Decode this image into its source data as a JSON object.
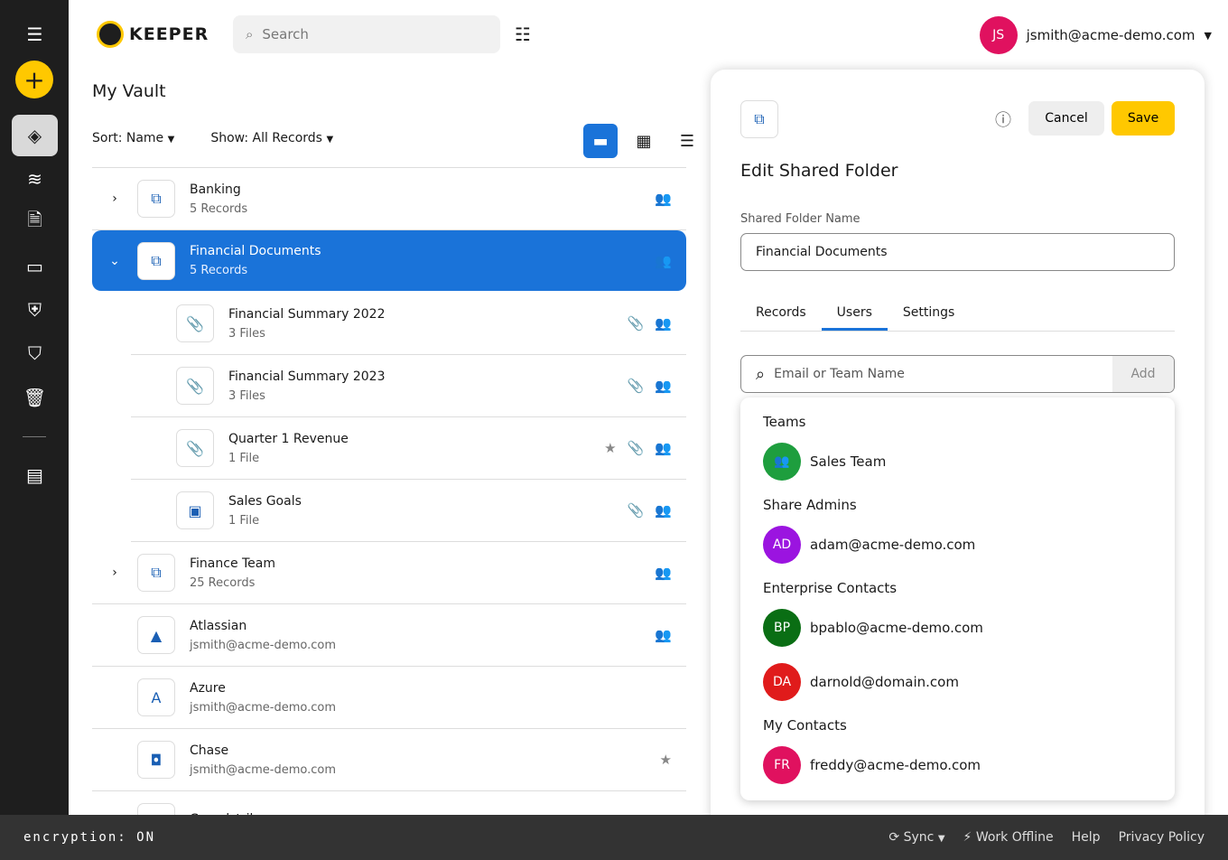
{
  "header": {
    "logo": "KEEPER",
    "search_placeholder": "Search",
    "user_initials": "JS",
    "user_email": "jsmith@acme-demo.com",
    "avatar_color": "#e0115f"
  },
  "vault": {
    "title": "My Vault",
    "sort": "Sort: Name",
    "show": "Show: All Records"
  },
  "records": [
    {
      "title": "Banking",
      "sub": "5 Records",
      "type": "folder",
      "expand": "collapsed",
      "icons": [
        "shared"
      ]
    },
    {
      "title": "Financial Documents",
      "sub": "5 Records",
      "type": "folder",
      "expand": "expanded",
      "selected": true,
      "icons": [
        "shared"
      ]
    },
    {
      "title": "Financial Summary 2022",
      "sub": "3 Files",
      "type": "attachment",
      "child": true,
      "icons": [
        "attachment",
        "shared"
      ]
    },
    {
      "title": "Financial Summary 2023",
      "sub": "3 Files",
      "type": "attachment",
      "child": true,
      "icons": [
        "attachment",
        "shared"
      ]
    },
    {
      "title": "Quarter 1 Revenue",
      "sub": "1 File",
      "type": "attachment",
      "child": true,
      "icons": [
        "star",
        "attachment",
        "shared"
      ]
    },
    {
      "title": "Sales Goals",
      "sub": "1 File",
      "type": "image",
      "child": true,
      "icons": [
        "attachment",
        "shared"
      ]
    },
    {
      "title": "Finance Team",
      "sub": "25 Records",
      "type": "folder",
      "expand": "collapsed",
      "icons": [
        "shared"
      ]
    },
    {
      "title": "Atlassian",
      "sub": "jsmith@acme-demo.com",
      "type": "atlassian",
      "icons": [
        "shared"
      ]
    },
    {
      "title": "Azure",
      "sub": "jsmith@acme-demo.com",
      "type": "azure",
      "icons": []
    },
    {
      "title": "Chase",
      "sub": "jsmith@acme-demo.com",
      "type": "chase",
      "icons": [
        "star"
      ]
    },
    {
      "title": "Crowdstrike",
      "sub": "",
      "type": "crowdstrike",
      "icons": []
    }
  ],
  "panel": {
    "title": "Edit Shared Folder",
    "cancel": "Cancel",
    "save": "Save",
    "field_label": "Shared Folder Name",
    "field_value": "Financial Documents",
    "tabs": [
      "Records",
      "Users",
      "Settings"
    ],
    "active_tab": "Users",
    "user_search_placeholder": "Email or Team Name",
    "add": "Add",
    "groups": [
      {
        "label": "Teams",
        "items": [
          {
            "initials": "",
            "name": "Sales Team",
            "color": "#1e9e3e",
            "team": true
          }
        ]
      },
      {
        "label": "Share Admins",
        "items": [
          {
            "initials": "AD",
            "name": "adam@acme-demo.com",
            "color": "#9b14e0"
          }
        ]
      },
      {
        "label": "Enterprise Contacts",
        "items": [
          {
            "initials": "BP",
            "name": "bpablo@acme-demo.com",
            "color": "#0a6e14"
          },
          {
            "initials": "DA",
            "name": "darnold@domain.com",
            "color": "#e01b1b"
          }
        ]
      },
      {
        "label": "My Contacts",
        "items": [
          {
            "initials": "FR",
            "name": "freddy@acme-demo.com",
            "color": "#e0115f"
          }
        ]
      }
    ]
  },
  "footer": {
    "encryption": "encryption: ON",
    "sync": "Sync",
    "work_offline": "Work Offline",
    "help": "Help",
    "privacy": "Privacy Policy"
  }
}
